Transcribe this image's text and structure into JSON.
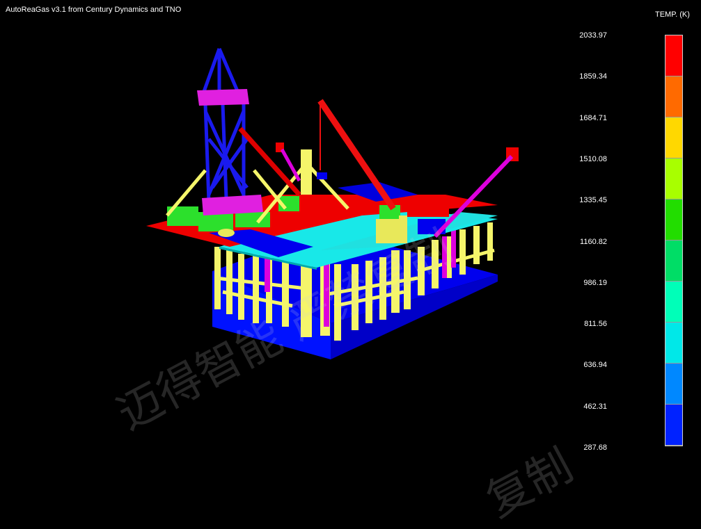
{
  "window": {
    "title": "AutoReaGas v3.1 from Century Dynamics and TNO"
  },
  "legend": {
    "title": "TEMP. (K)",
    "ticks": [
      "2033.97",
      "1859.34",
      "1684.71",
      "1510.08",
      "1335.45",
      "1160.82",
      "986.19",
      "811.56",
      "636.94",
      "462.31",
      "287.68"
    ],
    "colors": [
      "#ff0000",
      "#ff6a00",
      "#ffd800",
      "#a8ff00",
      "#22dd00",
      "#00dd66",
      "#00ffb8",
      "#00e8e8",
      "#0088ff",
      "#0022ff"
    ]
  },
  "watermark": {
    "primary": "迈得智能 严禁复制",
    "secondary": "复制"
  }
}
